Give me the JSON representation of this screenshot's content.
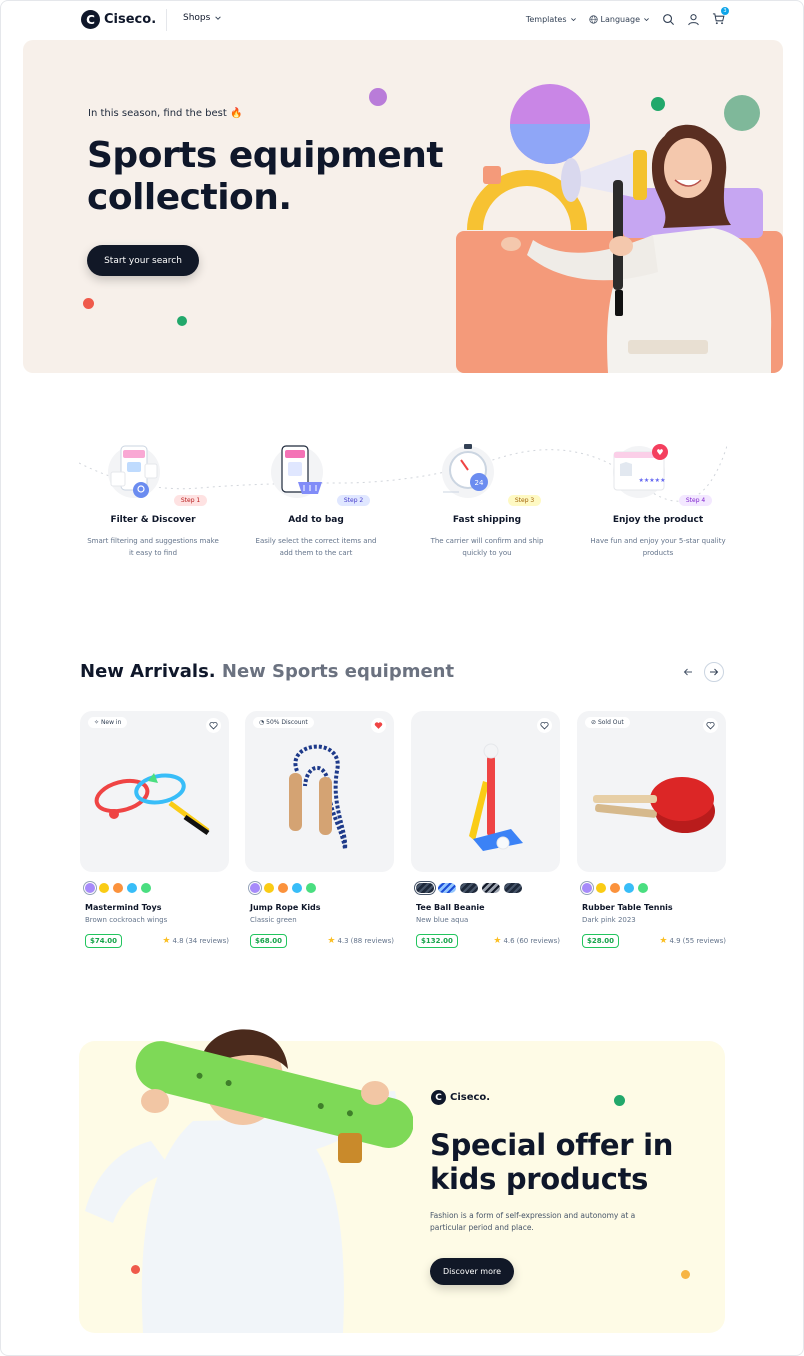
{
  "header": {
    "logo_text": "Ciseco.",
    "logo_letter": "C",
    "shops_label": "Shops",
    "templates_label": "Templates",
    "language_label": "Language",
    "cart_count": "3"
  },
  "hero": {
    "subtitle": "In this season, find the best 🔥",
    "title": "Sports equipment collection.",
    "cta_label": "Start your search"
  },
  "steps": [
    {
      "badge": "Step 1",
      "title": "Filter & Discover",
      "desc": "Smart filtering and suggestions make it easy to find",
      "badge_bg": "#fee2e2",
      "badge_color": "#b91c1c"
    },
    {
      "badge": "Step 2",
      "title": "Add to bag",
      "desc": "Easily select the correct items and add them to the cart",
      "badge_bg": "#e0e7ff",
      "badge_color": "#4338ca"
    },
    {
      "badge": "Step 3",
      "title": "Fast shipping",
      "desc": "The carrier will confirm and ship quickly to you",
      "badge_bg": "#fef9c3",
      "badge_color": "#a16207"
    },
    {
      "badge": "Step 4",
      "title": "Enjoy the product",
      "desc": "Have fun and enjoy your 5-star quality products",
      "badge_bg": "#f3e8ff",
      "badge_color": "#7e22ce"
    }
  ],
  "arrivals": {
    "heading": "New Arrivals.",
    "subheading": " New Sports equipment",
    "prev_icon": "arrow-left-icon",
    "next_icon": "arrow-right-icon"
  },
  "products": [
    {
      "tag": "New in",
      "name": "Mastermind Toys",
      "variant": "Brown cockroach wings",
      "price": "$74.00",
      "rating": "4.8",
      "reviews": "(34 reviews)",
      "liked": false,
      "swatches": [
        "#a78bfa",
        "#facc15",
        "#fb923c",
        "#38bdf8",
        "#4ade80"
      ]
    },
    {
      "tag": "50% Discount",
      "name": "Jump Rope Kids",
      "variant": "Classic green",
      "price": "$68.00",
      "rating": "4.3",
      "reviews": "(88 reviews)",
      "liked": true,
      "swatches": [
        "#a78bfa",
        "#facc15",
        "#fb923c",
        "#38bdf8",
        "#4ade80"
      ]
    },
    {
      "tag": "",
      "name": "Tee Ball Beanie",
      "variant": "New blue aqua",
      "price": "$132.00",
      "rating": "4.6",
      "reviews": "(60 reviews)",
      "liked": false,
      "swatches": [
        "pattern",
        "pattern",
        "pattern",
        "pattern",
        "pattern"
      ]
    },
    {
      "tag": "Sold Out",
      "name": "Rubber Table Tennis",
      "variant": "Dark pink 2023",
      "price": "$28.00",
      "rating": "4.9",
      "reviews": "(55 reviews)",
      "liked": false,
      "swatches": [
        "#a78bfa",
        "#facc15",
        "#fb923c",
        "#38bdf8",
        "#4ade80"
      ]
    }
  ],
  "promo": {
    "logo_text": "Ciseco.",
    "title": "Special offer in kids products",
    "desc": "Fashion is a form of self-expression and autonomy at a particular period and place.",
    "cta_label": "Discover more"
  },
  "colors": {
    "hero_bg": "#f7f0ea",
    "promo_bg": "#fefbe6",
    "dark": "#111827",
    "price_green": "#22c55e",
    "heart_red": "#ef4444"
  }
}
